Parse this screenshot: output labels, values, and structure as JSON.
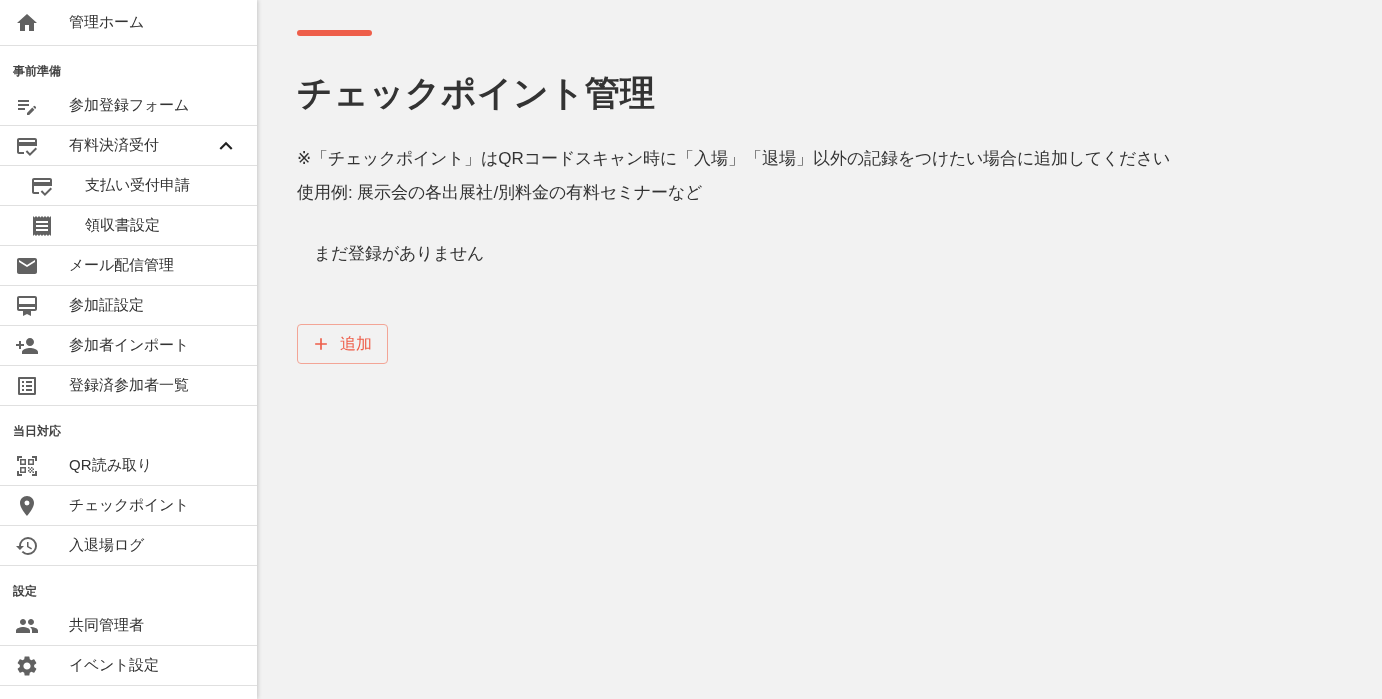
{
  "sidebar": {
    "home": {
      "label": "管理ホーム"
    },
    "sections": [
      {
        "title": "事前準備",
        "items": [
          {
            "label": "参加登録フォーム"
          },
          {
            "label": "有料決済受付",
            "expanded": true,
            "children": [
              {
                "label": "支払い受付申請"
              },
              {
                "label": "領収書設定"
              }
            ]
          },
          {
            "label": "メール配信管理"
          },
          {
            "label": "参加証設定"
          },
          {
            "label": "参加者インポート"
          },
          {
            "label": "登録済参加者一覧"
          }
        ]
      },
      {
        "title": "当日対応",
        "items": [
          {
            "label": "QR読み取り"
          },
          {
            "label": "チェックポイント"
          },
          {
            "label": "入退場ログ"
          }
        ]
      },
      {
        "title": "設定",
        "items": [
          {
            "label": "共同管理者"
          },
          {
            "label": "イベント設定"
          }
        ]
      }
    ]
  },
  "page": {
    "title": "チェックポイント管理",
    "notes": [
      "※「チェックポイント」はQRコードスキャン時に「入場」「退場」以外の記録をつけたい場合に追加してください",
      "使用例: 展示会の各出展社/別料金の有料セミナーなど"
    ],
    "empty_message": "まだ登録がありません",
    "add_button": {
      "label": "追加"
    }
  }
}
